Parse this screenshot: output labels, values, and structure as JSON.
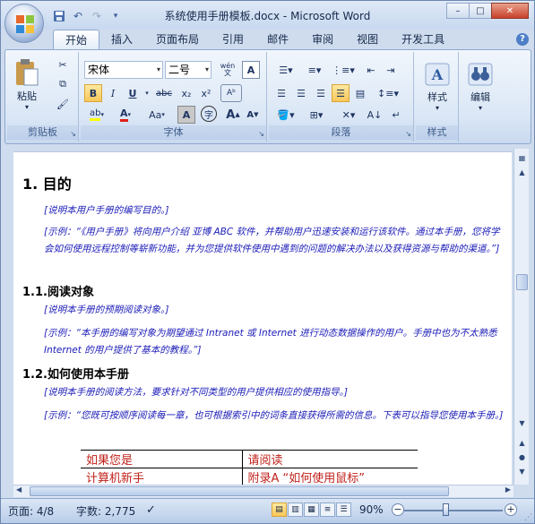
{
  "window": {
    "title": "系统使用手册模板.docx - Microsoft Word",
    "controls": {
      "minimize": "–",
      "maximize": "□",
      "close": "✕"
    }
  },
  "tabs": [
    {
      "label": "开始",
      "active": true
    },
    {
      "label": "插入"
    },
    {
      "label": "页面布局"
    },
    {
      "label": "引用"
    },
    {
      "label": "邮件"
    },
    {
      "label": "审阅"
    },
    {
      "label": "视图"
    },
    {
      "label": "开发工具"
    }
  ],
  "ribbon": {
    "clipboard": {
      "group_label": "剪贴板",
      "paste_label": "粘贴"
    },
    "font": {
      "group_label": "字体",
      "font_name": "宋体",
      "font_size": "二号",
      "wen_label": "wén\n文",
      "bold": "B",
      "italic": "I",
      "underline": "U",
      "strike": "abc",
      "subscript": "x₂",
      "superscript": "x²",
      "change_case": "Aa",
      "char_border": "A",
      "enclose": "字",
      "grow": "A",
      "shrink": "A",
      "highlight_color": "#ffff00",
      "font_color": "#e0201a"
    },
    "paragraph": {
      "group_label": "段落"
    },
    "styles": {
      "group_label": "样式",
      "label": "样式"
    },
    "editing": {
      "label": "编辑"
    }
  },
  "document": {
    "h1": "1.  目的",
    "note1": "[说明本用户手册的编写目的。]",
    "note2": "[示例：“《用户手册》将向用户介绍 亚博 ABC 软件，并帮助用户迅速安装和运行该软件。通过本手册，您将学会如何使用远程控制等崭新功能，并为您提供软件使用中遇到的问题的解决办法以及获得资源与帮助的渠道。”]",
    "h2_1": "1.1.阅读对象",
    "note3": "[说明本手册的预期阅读对象。]",
    "note4": "[示例：“本手册的编写对象为期望通过 Intranet 或 Internet 进行动态数据操作的用户。手册中也为不太熟悉 Internet 的用户提供了基本的教程。”]",
    "h2_2": "1.2.如何使用本手册",
    "note5": "[说明本手册的阅读方法，要求针对不同类型的用户提供相应的使用指导。]",
    "note6": "[示例：“您既可按顺序阅读每一章，也可根据索引中的词条直接获得所需的信息。下表可以指导您使用本手册。]",
    "table": [
      [
        "如果您是",
        "请阅读"
      ],
      [
        "计算机新手",
        "附录A  “如何使用鼠标”"
      ]
    ]
  },
  "status": {
    "page": "页面: 4/8",
    "words": "字数: 2,775",
    "zoom": "90%"
  }
}
